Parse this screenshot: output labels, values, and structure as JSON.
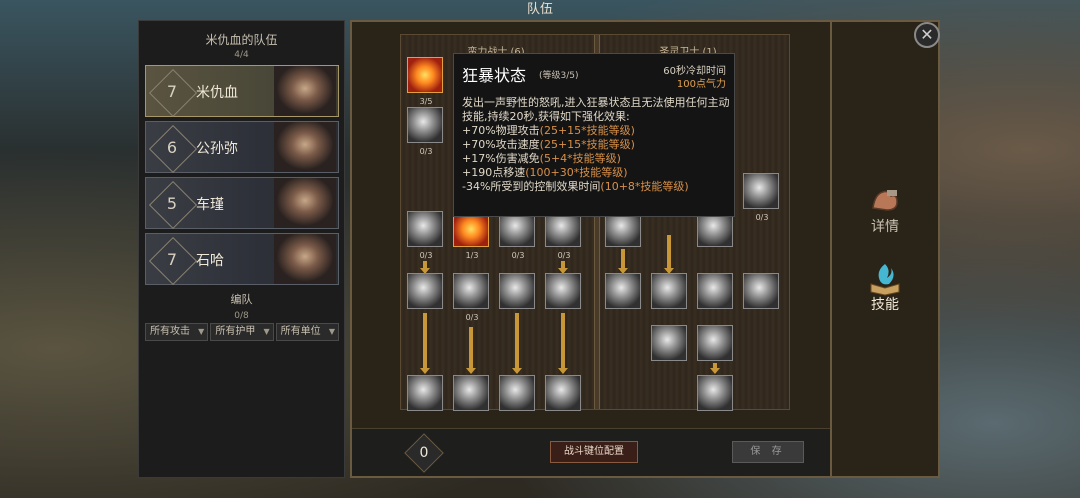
{
  "window": {
    "title": "队伍"
  },
  "party": {
    "header": "米仇血的队伍",
    "count": "4/4",
    "members": [
      {
        "level": "7",
        "name": "米仇血",
        "selected": true
      },
      {
        "level": "6",
        "name": "公孙弥",
        "selected": false
      },
      {
        "level": "5",
        "name": "车瑾",
        "selected": false
      },
      {
        "level": "7",
        "name": "石哈",
        "selected": false
      }
    ],
    "formation_title": "编队",
    "formation_count": "0/8",
    "filters": [
      "所有攻击",
      "所有护甲",
      "所有单位"
    ]
  },
  "skill_tree": {
    "columns": [
      "蛮力战士 (6)",
      "圣灵卫士 (1)"
    ],
    "levels": {
      "top": "3/5",
      "second": "0/3",
      "row3": [
        "0/3",
        "1/3",
        "0/3",
        "0/3"
      ],
      "row4_mid": "0/3",
      "right_shield": "0/3"
    }
  },
  "tooltip": {
    "name": "狂暴状态",
    "level": "(等级3/5)",
    "cooldown": "60秒冷却时间",
    "cost": "100点气力",
    "description": "发出一声野性的怒吼,进入狂暴状态且无法使用任何主动技能,持续20秒,获得如下强化效果:",
    "lines": [
      {
        "text": "+70%物理攻击",
        "formula": "(25+15*技能等级)"
      },
      {
        "text": "+70%攻击速度",
        "formula": "(25+15*技能等级)"
      },
      {
        "text": "+17%伤害减免",
        "formula": "(5+4*技能等级)"
      },
      {
        "text": "+190点移速",
        "formula": "(100+30*技能等级)"
      },
      {
        "text": "-34%所受到的控制效果时间",
        "formula": "(10+8*技能等级)"
      }
    ]
  },
  "bottom": {
    "points": "0",
    "config_label": "战斗键位配置",
    "save_label": "保 存"
  },
  "right_tabs": [
    {
      "label": "详情",
      "icon": "muscle-arm-icon",
      "active": false
    },
    {
      "label": "技能",
      "icon": "skill-book-icon",
      "active": true
    }
  ],
  "close_icon": "close-icon",
  "colors": {
    "accent": "#c89838",
    "formula": "#d89048",
    "selected_border": "#a89868"
  }
}
